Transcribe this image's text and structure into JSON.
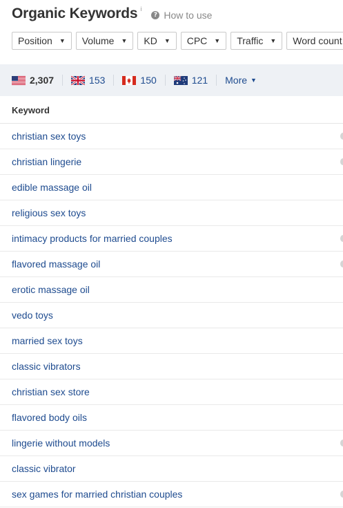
{
  "header": {
    "title": "Organic Keywords",
    "info": "i",
    "howto_label": "How to use"
  },
  "filters": [
    {
      "label": "Position"
    },
    {
      "label": "Volume"
    },
    {
      "label": "KD"
    },
    {
      "label": "CPC"
    },
    {
      "label": "Traffic"
    },
    {
      "label": "Word count"
    }
  ],
  "countries": [
    {
      "code": "us",
      "count": "2,307",
      "active": true
    },
    {
      "code": "gb",
      "count": "153"
    },
    {
      "code": "ca",
      "count": "150"
    },
    {
      "code": "au",
      "count": "121"
    }
  ],
  "more_label": "More",
  "table": {
    "header": "Keyword",
    "rows": [
      "christian sex toys",
      "christian lingerie",
      "edible massage oil",
      "religious sex toys",
      "intimacy products for married couples",
      "flavored massage oil",
      "erotic massage oil",
      "vedo toys",
      "married sex toys",
      "classic vibrators",
      "christian sex store",
      "flavored body oils",
      "lingerie without models",
      "classic vibrator",
      "sex games for married christian couples"
    ]
  }
}
